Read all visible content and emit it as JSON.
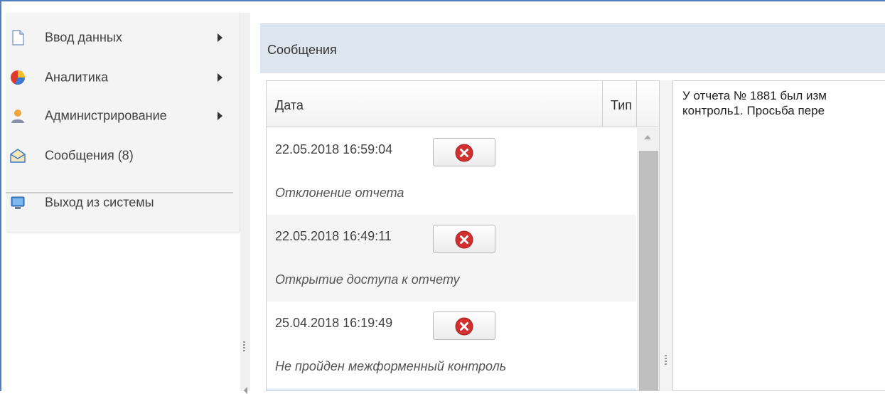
{
  "menu": {
    "items": [
      {
        "label": "Ввод данных",
        "icon": "document-icon",
        "has_submenu": true
      },
      {
        "label": "Аналитика",
        "icon": "pie-chart-icon",
        "has_submenu": true
      },
      {
        "label": "Администрирование",
        "icon": "user-icon",
        "has_submenu": true
      },
      {
        "label": "Сообщения (8)",
        "icon": "envelope-icon",
        "has_submenu": false
      },
      {
        "label": "Выход из системы",
        "icon": "monitor-icon",
        "has_submenu": false
      }
    ]
  },
  "panel": {
    "title": "Сообщения"
  },
  "grid": {
    "columns": [
      "Дата",
      "Тип"
    ],
    "rows": [
      {
        "date": "22.05.2018 16:59:04",
        "type": "Отклонение отчета"
      },
      {
        "date": "22.05.2018 16:49:11",
        "type": "Открытие доступа к отчету"
      },
      {
        "date": "25.04.2018 16:19:49",
        "type": "Не пройден межформенный контроль"
      }
    ]
  },
  "detail": {
    "line1": "У отчета № 1881 был изм",
    "line2": "контроль1. Просьба пере"
  },
  "colors": {
    "accent": "#4f7fbf",
    "header_bg": "#dde6ef",
    "delete_red": "#d32f2f"
  }
}
